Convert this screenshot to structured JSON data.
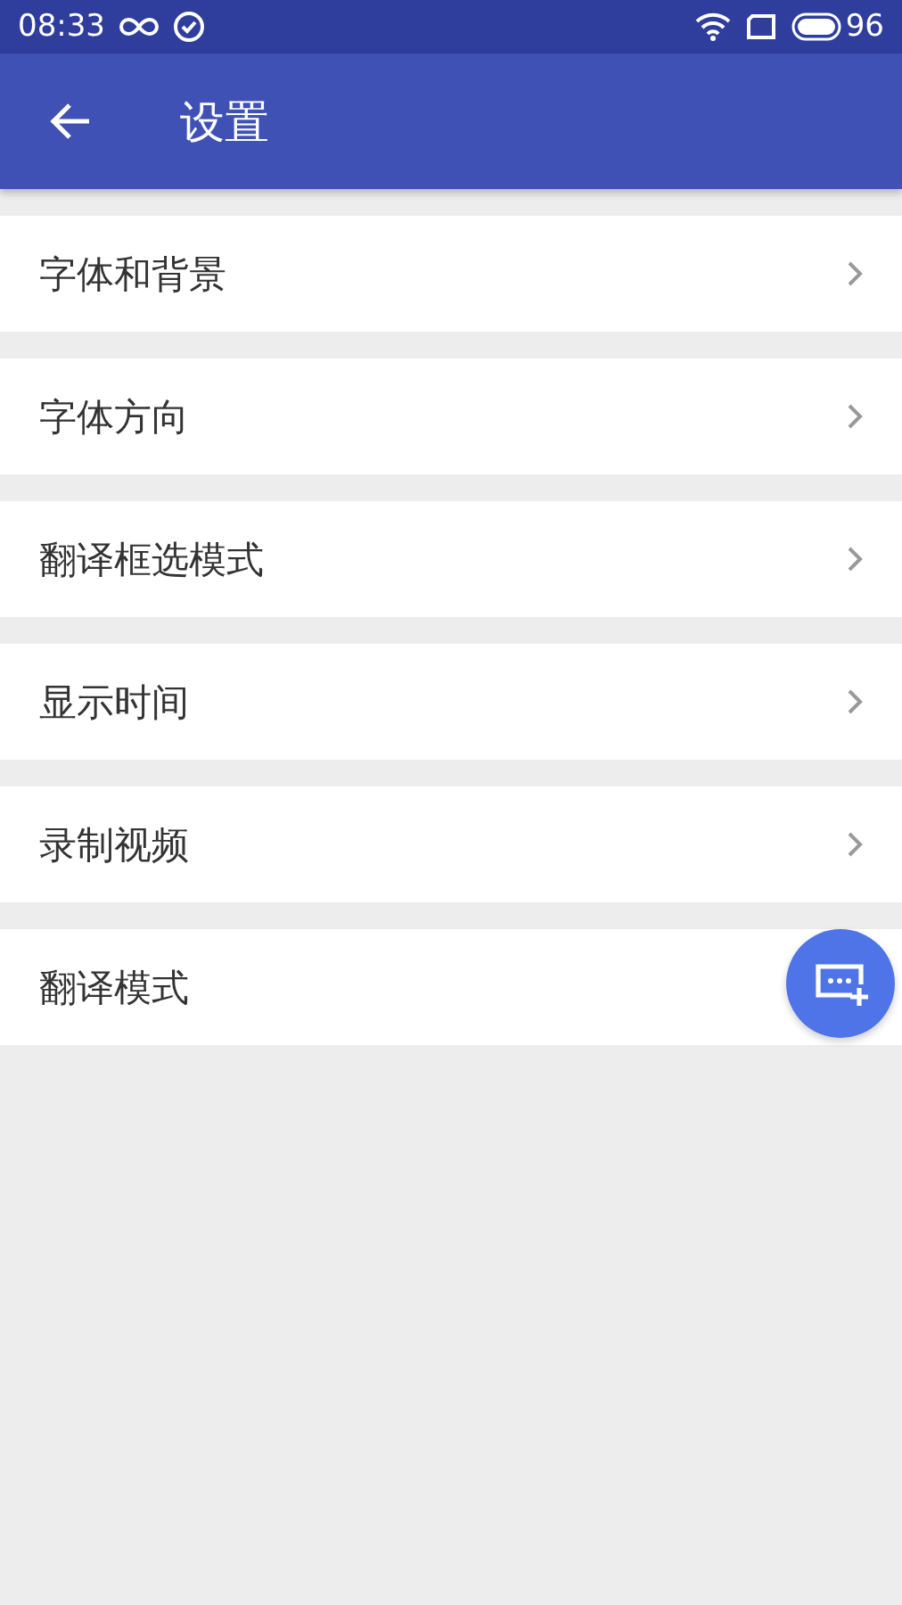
{
  "status_bar": {
    "time": "08:33",
    "battery": "96"
  },
  "toolbar": {
    "title": "设置"
  },
  "items": [
    {
      "label": "字体和背景"
    },
    {
      "label": "字体方向"
    },
    {
      "label": "翻译框选模式"
    },
    {
      "label": "显示时间"
    },
    {
      "label": "录制视频"
    },
    {
      "label": "翻译模式"
    }
  ]
}
